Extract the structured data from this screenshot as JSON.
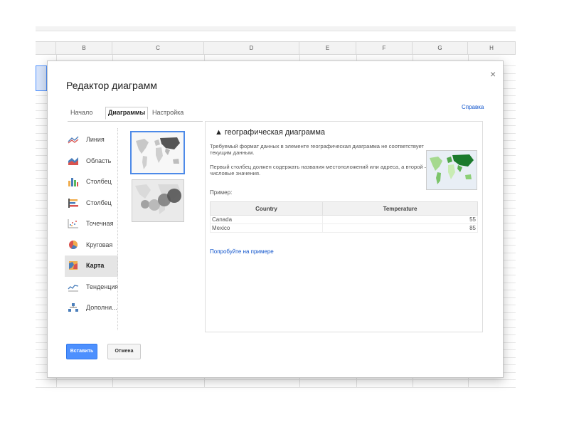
{
  "spreadsheet": {
    "columns": [
      "B",
      "C",
      "D",
      "E",
      "F",
      "G",
      "H"
    ],
    "selected_column": "B"
  },
  "dialog": {
    "title": "Редактор диаграмм",
    "help_link": "Справка",
    "close_glyph": "×",
    "tabs": [
      "Начало",
      "Диаграммы",
      "Настройка"
    ],
    "active_tab": "Диаграммы",
    "chart_types": [
      {
        "label": "Линия",
        "icon": "line-chart-icon"
      },
      {
        "label": "Область",
        "icon": "area-chart-icon"
      },
      {
        "label": "Столбец",
        "icon": "column-chart-icon"
      },
      {
        "label": "Столбец",
        "icon": "bar-chart-icon"
      },
      {
        "label": "Точечная",
        "icon": "scatter-chart-icon"
      },
      {
        "label": "Круговая",
        "icon": "pie-chart-icon"
      },
      {
        "label": "Карта",
        "icon": "map-chart-icon"
      },
      {
        "label": "Тенденция",
        "icon": "trend-chart-icon"
      },
      {
        "label": "Дополни...",
        "icon": "more-charts-icon"
      }
    ],
    "selected_chart_type": "Карта",
    "panel": {
      "warning_glyph": "▲",
      "heading": "географическая диаграмма",
      "message1": "Требуемый формат данных в элементе географическая диаграмма не соответствует текущим данным.",
      "message2": "Первый столбец должен содержать названия местоположений или адреса, а второй – числовые значения.",
      "example_label": "Пример:",
      "table": {
        "headers": [
          "Country",
          "Temperature"
        ],
        "rows": [
          [
            "Canada",
            "55"
          ],
          [
            "Mexico",
            "85"
          ]
        ]
      },
      "try_link": "Попробуйте на примере"
    },
    "insert_button": "Вставить",
    "cancel_button": "Отмена"
  },
  "colors": {
    "accent": "#4d90fe",
    "link": "#1155cc",
    "map_green_dark": "#1b7a2c",
    "map_green_light": "#a5d98f"
  }
}
